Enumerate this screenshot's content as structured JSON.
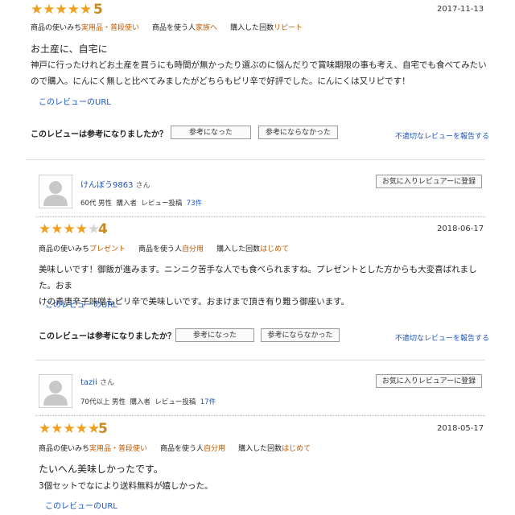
{
  "colors": {
    "star": "#f0a020",
    "star_off": "#d4d4d4",
    "link": "#1a55c0",
    "meta_value": "#c05a00"
  },
  "reviews": [
    {
      "stars_filled": 5,
      "stars_total": 5,
      "stars_text": "★★★★★",
      "rating": "5",
      "date": "2017-11-13",
      "meta": [
        {
          "label": "商品の使いみち",
          "value": "実用品・普段使い"
        },
        {
          "label": "商品を使う人",
          "value": "家族へ"
        },
        {
          "label": "購入した回数",
          "value": "リピート"
        }
      ],
      "title": "お土産に、自宅に",
      "body_lines": [
        "神戸に行ったけれどお土産を買うにも時間が無かったり選ぶのに悩んだりで賞味期限の事も考え、自宅でも食べてみたい",
        "ので購入。にんにく無しと比べてみましたがどちらもピリ辛で好評でした。にんにくは又リピです！"
      ],
      "url_label": "このレビューのURL",
      "helpful_question": "このレビューは参考になりましたか？",
      "yes_label": "参考になった",
      "no_label": "参考にならなかった",
      "report_label": "不適切なレビューを報告する"
    },
    {
      "reviewer": {
        "name": "けんぼう9863",
        "suffix": "さん",
        "age": "60代",
        "gender": "男性",
        "buyer": "購入者",
        "posts_label": "レビュー投稿",
        "posts_count": "73件"
      },
      "fav_label": "お気に入りレビュアーに登録",
      "stars_filled": 4,
      "stars_total": 5,
      "stars_on": "★★★★",
      "stars_off": "★",
      "rating": "4",
      "date": "2018-06-17",
      "meta": [
        {
          "label": "商品の使いみち",
          "value": "プレゼント"
        },
        {
          "label": "商品を使う人",
          "value": "自分用"
        },
        {
          "label": "購入した回数",
          "value": "はじめて"
        }
      ],
      "body_lines": [
        "美味しいです！御飯が進みます。ニンニク苦手な人でも食べられますね。プレゼントとした方からも大変喜ばれました。おま",
        "けの青唐辛子味噌もピリ辛で美味しいです。おまけまで頂き有り難う御座います。"
      ],
      "url_label": "このレビューのURL",
      "helpful_question": "このレビューは参考になりましたか？",
      "yes_label": "参考になった",
      "no_label": "参考にならなかった",
      "report_label": "不適切なレビューを報告する"
    },
    {
      "reviewer": {
        "name": "tazii",
        "suffix": "さん",
        "age": "70代以上",
        "gender": "男性",
        "buyer": "購入者",
        "posts_label": "レビュー投稿",
        "posts_count": "17件"
      },
      "fav_label": "お気に入りレビュアーに登録",
      "stars_filled": 5,
      "stars_total": 5,
      "stars_text": "★★★★★",
      "rating": "5",
      "date": "2018-05-17",
      "meta": [
        {
          "label": "商品の使いみち",
          "value": "実用品・普段使い"
        },
        {
          "label": "商品を使う人",
          "value": "自分用"
        },
        {
          "label": "購入した回数",
          "value": "はじめて"
        }
      ],
      "title": "たいへん美味しかったです。",
      "body_lines": [
        "3個セットでなにより送料無料が嬉しかった。"
      ],
      "url_label": "このレビューのURL"
    }
  ]
}
